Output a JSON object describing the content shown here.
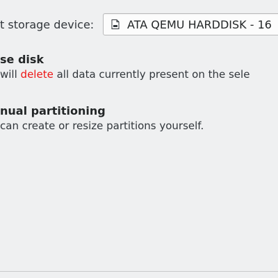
{
  "device": {
    "label": "t storage device:",
    "selected": "ATA QEMU HARDDISK - 16",
    "icon": "drive-harddisk-icon"
  },
  "options": {
    "erase": {
      "title": "se disk",
      "desc_pre": " will ",
      "desc_highlight": "delete",
      "desc_post": " all data currently present on the sele",
      "highlight_color": "#ed1515"
    },
    "manual": {
      "title": "nual partitioning",
      "desc": " can create or resize partitions yourself."
    }
  }
}
